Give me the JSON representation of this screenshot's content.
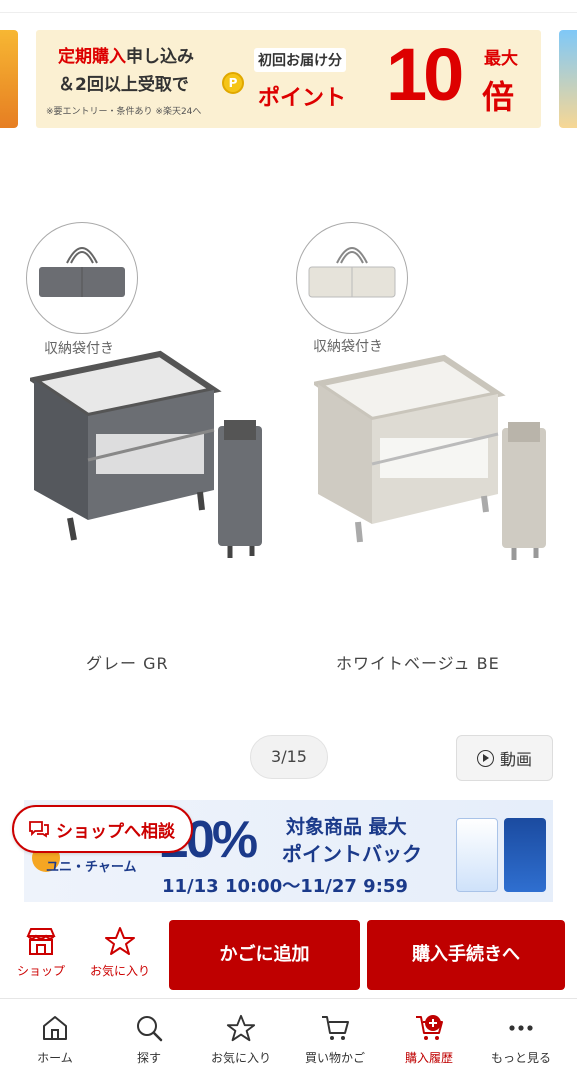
{
  "promo_banner": {
    "line1_red": "定期購入",
    "line1_rest": "申し込み",
    "line2": "＆2回以上受取で",
    "note": "※要エントリー・条件あり ※楽天24へ",
    "first_delivery": "初回お届け分",
    "points": "ポイント",
    "multiplier": "10",
    "max": "最大",
    "times": "倍"
  },
  "product": {
    "storage_bag_caption": "収納袋付き",
    "variants": [
      {
        "label": "グレー GR",
        "color": "#5d5f63"
      },
      {
        "label": "ホワイトベージュ BE",
        "color": "#d9d6cf"
      }
    ]
  },
  "gallery": {
    "counter": "3/15",
    "video_label": "動画"
  },
  "unicharm_banner": {
    "brand": "ユニ・チャーム",
    "percent": "20%",
    "headline1": "対象商品 最大",
    "headline2": "ポイントバック",
    "period": "11/13 10:00～11/27 9:59"
  },
  "consult_button": "ショップへ相談",
  "action_bar": {
    "shop_label": "ショップ",
    "fav_label": "お気に入り",
    "add_to_cart": "かごに追加",
    "checkout": "購入手続きへ"
  },
  "bottom_nav": [
    {
      "label": "ホーム",
      "icon": "home-icon"
    },
    {
      "label": "探す",
      "icon": "search-icon"
    },
    {
      "label": "お気に入り",
      "icon": "star-icon"
    },
    {
      "label": "買い物かご",
      "icon": "cart-icon"
    },
    {
      "label": "購入履歴",
      "icon": "purchase-history-icon",
      "active": true
    },
    {
      "label": "もっと見る",
      "icon": "more-icon"
    }
  ],
  "colors": {
    "accent": "#bf0000",
    "banner_bg": "#fbf0d2",
    "unicharm_blue": "#1b3a8a"
  }
}
